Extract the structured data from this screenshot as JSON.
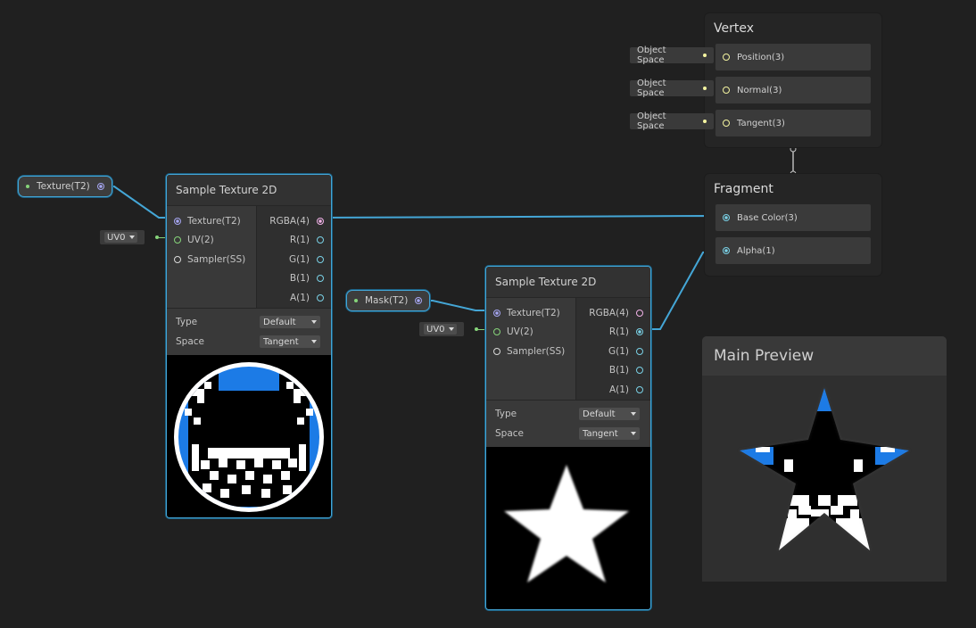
{
  "colors": {
    "background": "#202020",
    "wire": "#44a6d6",
    "texture_port": "#a6a6f2",
    "uv_port": "#86d47a",
    "float_port": "#7ad1e6",
    "vector3_port": "#f4f4a0",
    "preview_blue": "#1c7be6"
  },
  "texture_property": {
    "label": "Texture(T2)"
  },
  "mask_property": {
    "label": "Mask(T2)"
  },
  "sample_texture_1": {
    "title": "Sample Texture 2D",
    "inputs": [
      "Texture(T2)",
      "UV(2)",
      "Sampler(SS)"
    ],
    "outputs": [
      "RGBA(4)",
      "R(1)",
      "G(1)",
      "B(1)",
      "A(1)"
    ],
    "type_label": "Type",
    "type_value": "Default",
    "space_label": "Space",
    "space_value": "Tangent",
    "uv_value": "UV0"
  },
  "sample_texture_2": {
    "title": "Sample Texture 2D",
    "inputs": [
      "Texture(T2)",
      "UV(2)",
      "Sampler(SS)"
    ],
    "outputs": [
      "RGBA(4)",
      "R(1)",
      "G(1)",
      "B(1)",
      "A(1)"
    ],
    "type_label": "Type",
    "type_value": "Default",
    "space_label": "Space",
    "space_value": "Tangent",
    "uv_value": "UV0"
  },
  "vertex": {
    "title": "Vertex",
    "blocks": [
      "Position(3)",
      "Normal(3)",
      "Tangent(3)"
    ],
    "space_tags": [
      "Object Space",
      "Object Space",
      "Object Space"
    ]
  },
  "fragment": {
    "title": "Fragment",
    "blocks": [
      "Base Color(3)",
      "Alpha(1)"
    ]
  },
  "main_preview": {
    "title": "Main Preview"
  }
}
